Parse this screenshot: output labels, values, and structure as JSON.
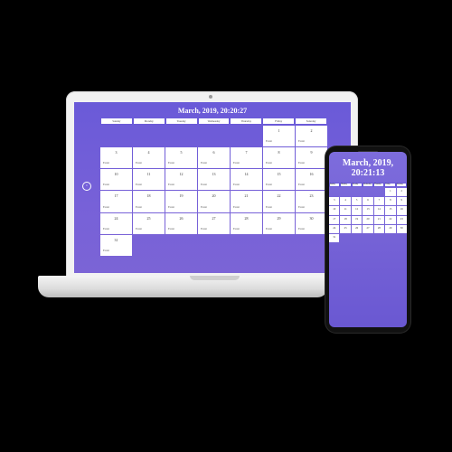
{
  "laptop": {
    "title": "March, 2019, 20:20:27",
    "prev_icon": "chevron-left-icon",
    "weekdays": [
      "Sunday",
      "Monday",
      "Tuesday",
      "Wednesday",
      "Thursday",
      "Friday",
      "Saturday"
    ],
    "cells": [
      "",
      "",
      "",
      "",
      "",
      "1",
      "2",
      "3",
      "4",
      "5",
      "6",
      "7",
      "8",
      "9",
      "10",
      "11",
      "12",
      "13",
      "14",
      "15",
      "16",
      "17",
      "18",
      "19",
      "20",
      "21",
      "22",
      "23",
      "24",
      "25",
      "26",
      "27",
      "28",
      "29",
      "30",
      "31",
      "",
      "",
      "",
      "",
      "",
      ""
    ],
    "cell_tag": "Event"
  },
  "phone": {
    "title": "March, 2019, 20:21:13",
    "weekdays": [
      "Sunday",
      "Monday",
      "Tuesday",
      "Wednesday",
      "Thursday",
      "Friday",
      "Saturday"
    ],
    "cells": [
      "",
      "",
      "",
      "",
      "",
      "1",
      "2",
      "3",
      "4",
      "5",
      "6",
      "7",
      "8",
      "9",
      "10",
      "11",
      "12",
      "13",
      "14",
      "15",
      "16",
      "17",
      "18",
      "19",
      "20",
      "21",
      "22",
      "23",
      "24",
      "25",
      "26",
      "27",
      "28",
      "29",
      "30",
      "31",
      "",
      "",
      "",
      "",
      "",
      ""
    ]
  },
  "colors": {
    "screen_bg": "#6a5ad8",
    "cell_bg": "#ffffff",
    "device_frame": "#111111"
  }
}
